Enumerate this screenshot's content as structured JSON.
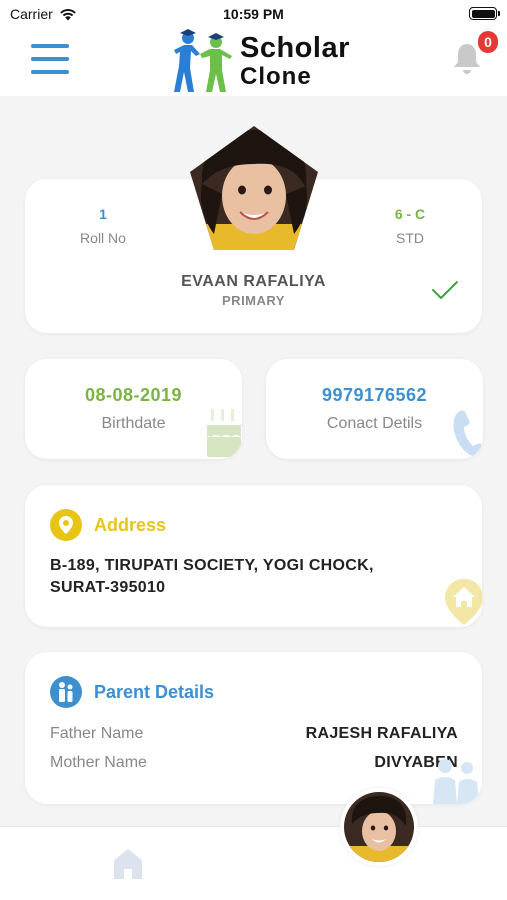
{
  "status_bar": {
    "carrier": "Carrier",
    "time": "10:59 PM"
  },
  "header": {
    "logo_line1": "Scholar",
    "logo_line2": "Clone",
    "notification_count": "0",
    "accent_color": "#3d8fd0"
  },
  "profile": {
    "roll_no": {
      "value": "1",
      "label": "Roll No"
    },
    "std": {
      "value": "6 - C",
      "label": "STD"
    },
    "name": "EVAAN RAFALIYA",
    "level": "PRIMARY"
  },
  "birthdate": {
    "value": "08-08-2019",
    "label": "Birthdate"
  },
  "contact": {
    "value": "9979176562",
    "label": "Conact Detils"
  },
  "address": {
    "title": "Address",
    "line1": "B-189, TIRUPATI SOCIETY, YOGI CHOCK,",
    "line2": "SURAT-395010"
  },
  "parents": {
    "title": "Parent Details",
    "father_label": "Father Name",
    "father_value": "RAJESH RAFALIYA",
    "mother_label": "Mother Name",
    "mother_value": "DIVYABEN"
  },
  "icons": {
    "menu": "hamburger-menu-icon",
    "bell": "bell-icon",
    "check": "check-icon",
    "cake": "cake-icon",
    "phone": "phone-icon",
    "location": "location-pin-icon",
    "home_location": "home-location-icon",
    "family": "family-icon",
    "home": "home-icon"
  },
  "colors": {
    "blue": "#3d8fd0",
    "green": "#7cb342",
    "yellow": "#e8c515",
    "badge_red": "#e53935"
  }
}
